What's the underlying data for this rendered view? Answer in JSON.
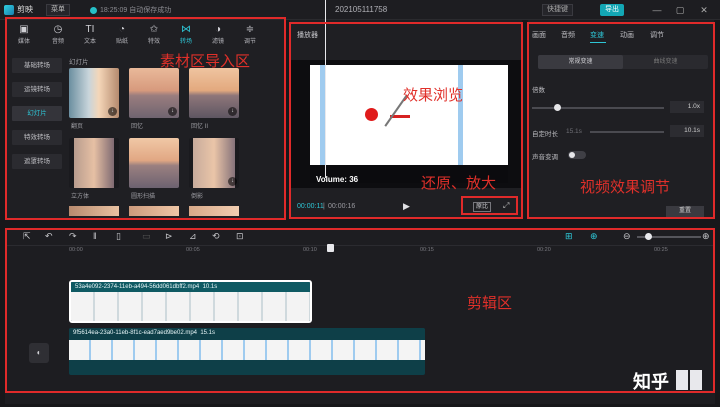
{
  "app": {
    "name": "剪映",
    "menu_label": "菜单",
    "autosave": "18:25:09 自动保存成功",
    "project_title": "202105111758",
    "shortcut_label": "快捷键",
    "export_label": "导出"
  },
  "window_controls": {
    "minimize": "—",
    "maximize": "▢",
    "close": "✕"
  },
  "toolbar": {
    "items": [
      {
        "label": "媒体",
        "icon": "▣"
      },
      {
        "label": "音频",
        "icon": "◷"
      },
      {
        "label": "文本",
        "icon": "TI"
      },
      {
        "label": "贴纸",
        "icon": "◔"
      },
      {
        "label": "特效",
        "icon": "✩"
      },
      {
        "label": "转场",
        "icon": "⋈"
      },
      {
        "label": "滤镜",
        "icon": "◑"
      },
      {
        "label": "调节",
        "icon": "≑"
      }
    ],
    "active_index": 5
  },
  "categories": [
    "基础转场",
    "运镜转场",
    "幻灯片",
    "特效转场",
    "遮罩转场"
  ],
  "active_category_index": 2,
  "section_label": "幻灯片",
  "transitions": [
    {
      "name": "翻页"
    },
    {
      "name": "回忆"
    },
    {
      "name": "回忆 II"
    },
    {
      "name": "立方体"
    },
    {
      "name": "圆形扫描"
    },
    {
      "name": "倒影"
    }
  ],
  "player": {
    "title": "播放器",
    "time_current": "00:00:11",
    "time_total": "00:00:16",
    "restore_label": "原比",
    "frame_caption": "Volume: 36"
  },
  "properties": {
    "tabs": [
      "画面",
      "音频",
      "变速",
      "动画",
      "调节"
    ],
    "active_tab_index": 2,
    "speed_tabs": [
      "常规变速",
      "曲线变速"
    ],
    "active_speed_tab_index": 0,
    "multiplier_label": "倍数",
    "multiplier_value": "1.0x",
    "duration_label": "自定时长",
    "duration_from": "15.1s",
    "duration_value": "10.1s",
    "pitch_label": "声音变调",
    "pitch_enabled": false,
    "reset_label": "重置"
  },
  "timeline": {
    "ruler_ticks": [
      "00:00",
      "00:05",
      "00:10",
      "00:15",
      "00:20",
      "00:25"
    ],
    "clips": [
      {
        "file": "53a4e092-2374-11eb-a494-56dd061dbff2.mp4",
        "duration": "10.1s"
      },
      {
        "file": "9f5614ea-23a0-11eb-8f1c-ead7aed9be02.mp4",
        "duration": "15.1s"
      }
    ]
  },
  "annotations": {
    "media": "素材区导入区",
    "preview": "效果浏览",
    "restore": "还原、放大",
    "effects": "视频效果调节",
    "edit": "剪辑区"
  },
  "watermark": {
    "text": "知乎"
  },
  "colors": {
    "accent": "#2ec6d6",
    "annotation": "#e02a2a"
  }
}
